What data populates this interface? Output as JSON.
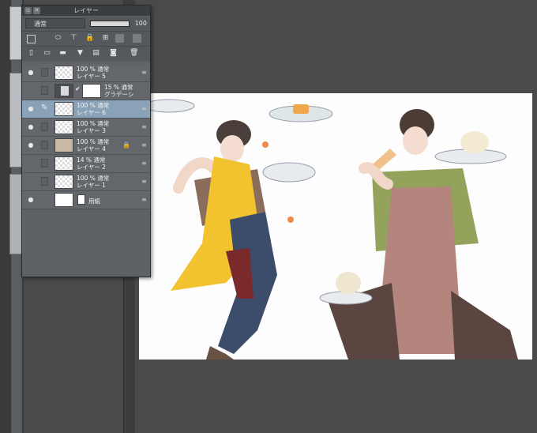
{
  "panel": {
    "title": "レイヤー",
    "blend_mode": "通常",
    "opacity_value": "100",
    "opacity_fraction": 1.0,
    "title_icons": [
      "collapse-icon",
      "close-icon"
    ],
    "toolbar1_icons": [
      "selection-icon",
      "ruler-icon",
      "clip-icon",
      "lock-icon",
      "lock-transparency-icon",
      "reference-icon",
      "draft-icon"
    ],
    "toolbar2_icons": [
      "new-raster-layer-icon",
      "new-vector-layer-icon",
      "new-folder-icon",
      "transfer-down-icon",
      "combine-down-icon",
      "mask-icon",
      "delete-icon"
    ]
  },
  "layers": [
    {
      "line1": "100 % 通常",
      "line2": "レイヤー 5",
      "visible": true,
      "thumb": "transparent"
    },
    {
      "line1": "15 % 通常",
      "line2": "グラデーシ",
      "visible": false,
      "thumb": "gradient",
      "has_mask": true
    },
    {
      "line1": "100 % 通常",
      "line2": "レイヤー 6",
      "visible": true,
      "thumb": "transparent",
      "selected": true
    },
    {
      "line1": "100 % 通常",
      "line2": "レイヤー 3",
      "visible": true,
      "thumb": "transparent"
    },
    {
      "line1": "100 % 通常",
      "line2": "レイヤー 4",
      "visible": true,
      "thumb": "artwork",
      "locked": true
    },
    {
      "line1": "14 % 通常",
      "line2": "レイヤー 2",
      "visible": false,
      "thumb": "transparent"
    },
    {
      "line1": "100 % 通常",
      "line2": "レイヤー 1",
      "visible": false,
      "thumb": "transparent"
    },
    {
      "line1": "",
      "line2": "用紙",
      "visible": true,
      "thumb": "white"
    }
  ],
  "canvas": {
    "background_color": "#fdfdfd",
    "illustration": "two-waiters-illustration"
  }
}
